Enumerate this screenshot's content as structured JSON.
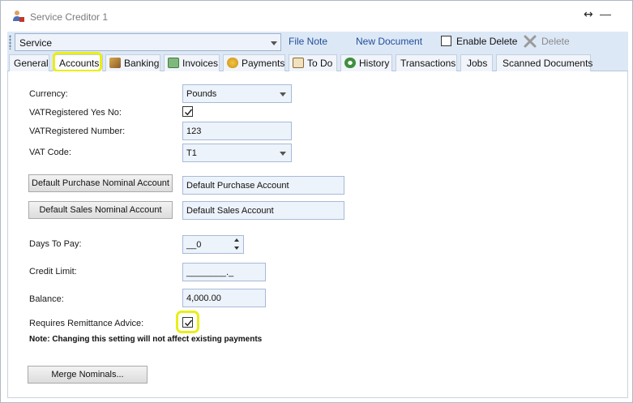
{
  "window": {
    "title": "Service Creditor 1",
    "resize_glyph": "↔",
    "minimize_glyph": "—"
  },
  "toolbar": {
    "service_value": "Service",
    "file_note": "File Note",
    "new_document": "New Document",
    "enable_delete": "Enable Delete",
    "delete": "Delete"
  },
  "tabs": [
    {
      "label": "General",
      "icon": ""
    },
    {
      "label": "Accounts",
      "icon": ""
    },
    {
      "label": "Banking",
      "icon": "banking-icon"
    },
    {
      "label": "Invoices",
      "icon": "invoices-icon"
    },
    {
      "label": "Payments",
      "icon": "payments-icon"
    },
    {
      "label": "To Do",
      "icon": "todo-icon"
    },
    {
      "label": "History",
      "icon": "history-icon"
    },
    {
      "label": "Transactions",
      "icon": ""
    },
    {
      "label": "Jobs",
      "icon": ""
    },
    {
      "label": "Scanned Documents",
      "icon": ""
    }
  ],
  "active_tab": "Accounts",
  "form": {
    "currency_label": "Currency:",
    "currency_value": "Pounds",
    "vat_registered_label": "VATRegistered Yes No:",
    "vat_registered_checked": true,
    "vat_number_label": "VATRegistered Number:",
    "vat_number_value": "123",
    "vat_code_label": "VAT Code:",
    "vat_code_value": "T1",
    "purchase_button": "Default Purchase Nominal Account",
    "purchase_value": "Default Purchase Account",
    "sales_button": "Default Sales Nominal Account",
    "sales_value": "Default Sales Account",
    "days_label": "Days To Pay:",
    "days_value": "__0",
    "credit_label": "Credit Limit:",
    "credit_value": "________._",
    "balance_label": "Balance:",
    "balance_value": "4,000.00",
    "remittance_label": "Requires Remittance Advice:",
    "remittance_checked": true,
    "note_text": "Note:  Changing this setting will not affect existing payments",
    "merge_button": "Merge Nominals..."
  },
  "colors": {
    "highlight": "#e9ee19",
    "toolbar_bg": "#dde8f6",
    "link": "#1f4e99",
    "field_bg": "#edf3fb"
  }
}
